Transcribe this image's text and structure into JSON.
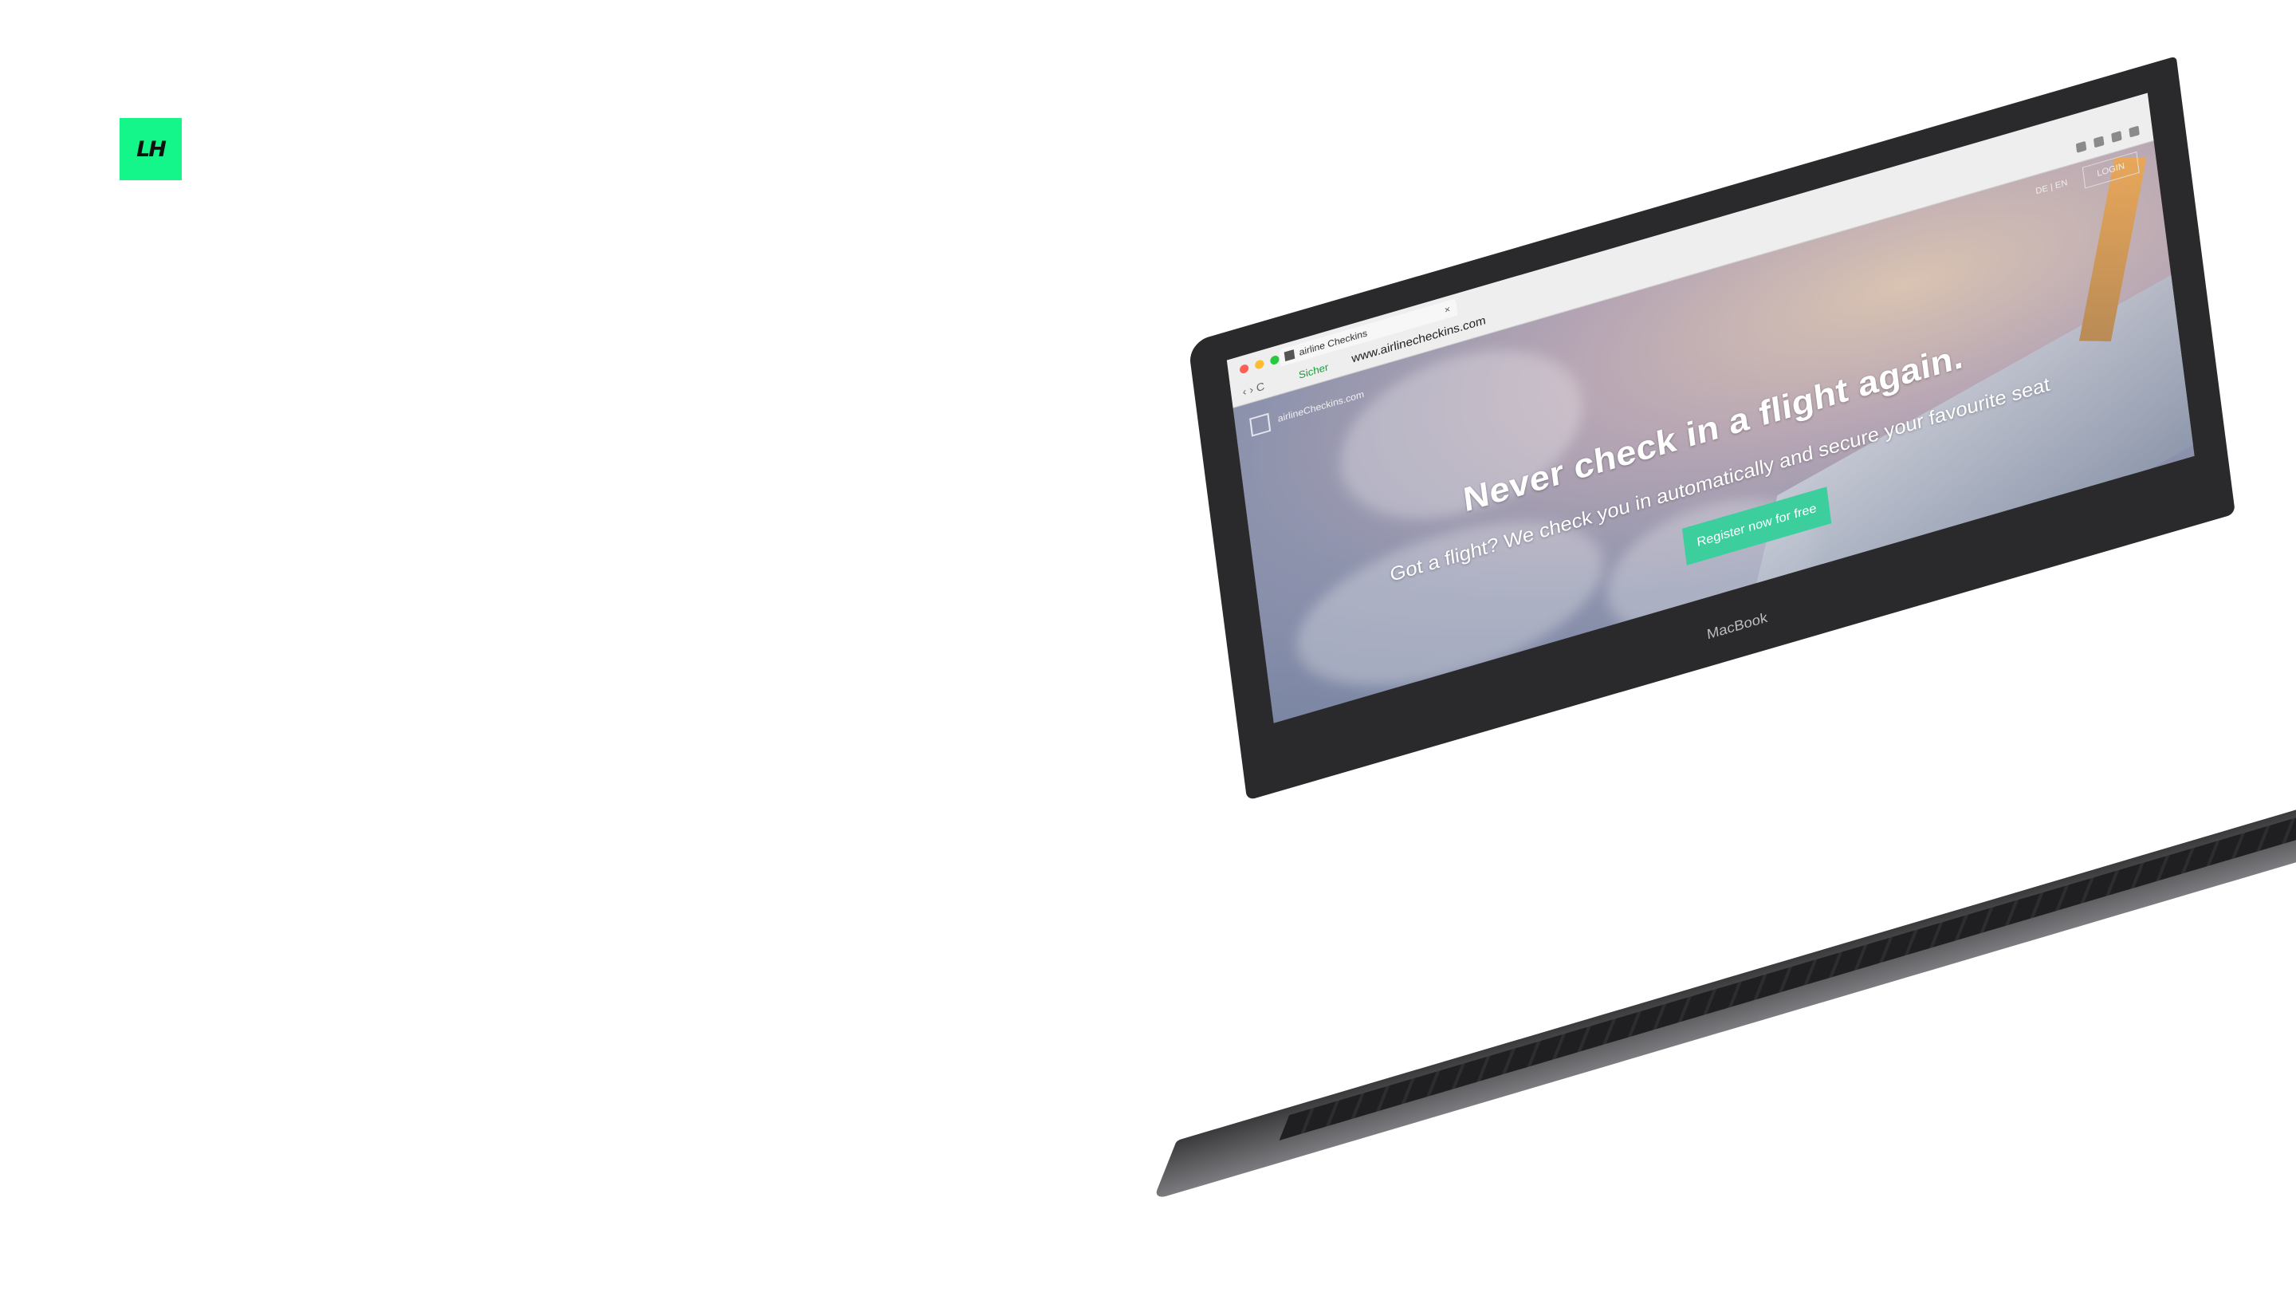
{
  "logo": {
    "text": "LH",
    "color": "#14f58a"
  },
  "browser": {
    "tab_title": "airline Checkins",
    "tab_close": "×",
    "nav_buttons": "‹ › C",
    "secure_label": "Sicher",
    "url": "www.airlinecheckins.com",
    "traffic_lights": [
      "#ff5f57",
      "#febc2e",
      "#28c840"
    ]
  },
  "website": {
    "site_name": "airlineCheckins.com",
    "lang": "DE | EN",
    "login_label": "LOGIN",
    "headline": "Never check in a flight again.",
    "subheadline": "Got a flight? We check you in automatically and secure your favourite seat",
    "cta_label": "Register now for free",
    "cta_color": "#3ccf9d"
  },
  "device": {
    "brand_label": "MacBook"
  }
}
